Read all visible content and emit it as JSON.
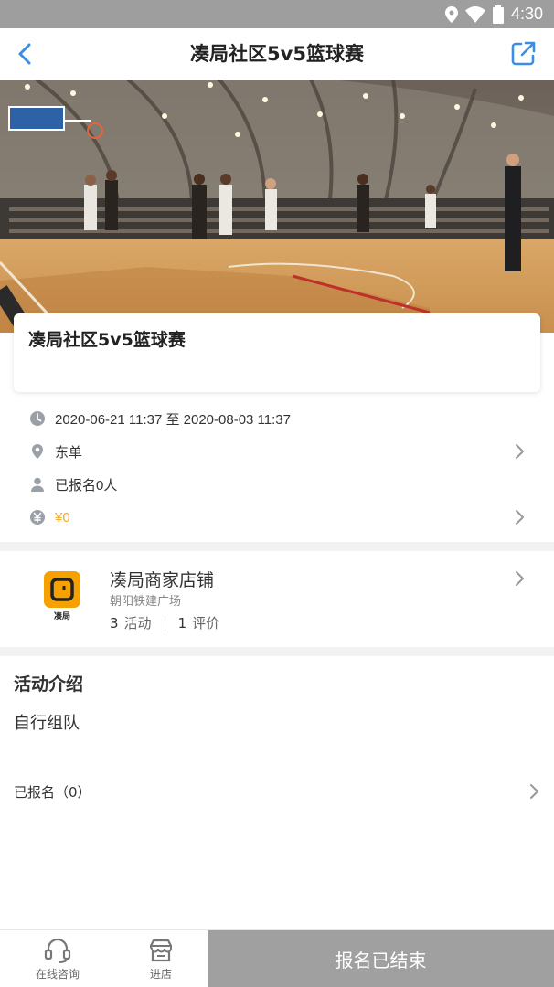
{
  "status_bar": {
    "time": "4:30"
  },
  "nav": {
    "title": "凑局社区5v5篮球赛"
  },
  "event": {
    "title": "凑局社区5v5篮球赛",
    "time_range": "2020-06-21 11:37 至 2020-08-03 11:37",
    "location": "东单",
    "registered": "已报名0人",
    "price": "¥0"
  },
  "shop": {
    "logo_text": "凑局",
    "name": "凑局商家店铺",
    "address": "朝阳铁建广场",
    "activities_count": "3",
    "activities_label": "活动",
    "reviews_count": "1",
    "reviews_label": "评价"
  },
  "intro": {
    "title": "活动介绍",
    "body": "自行组队",
    "registered_label": "已报名（0）"
  },
  "bottom": {
    "consult_label": "在线咨询",
    "shop_label": "进店",
    "signup_label": "报名已结束"
  },
  "colors": {
    "accent_blue": "#3a8ee6",
    "price_orange": "#f5a623",
    "shop_logo": "#f5a100",
    "disabled_button": "#a0a0a0"
  }
}
